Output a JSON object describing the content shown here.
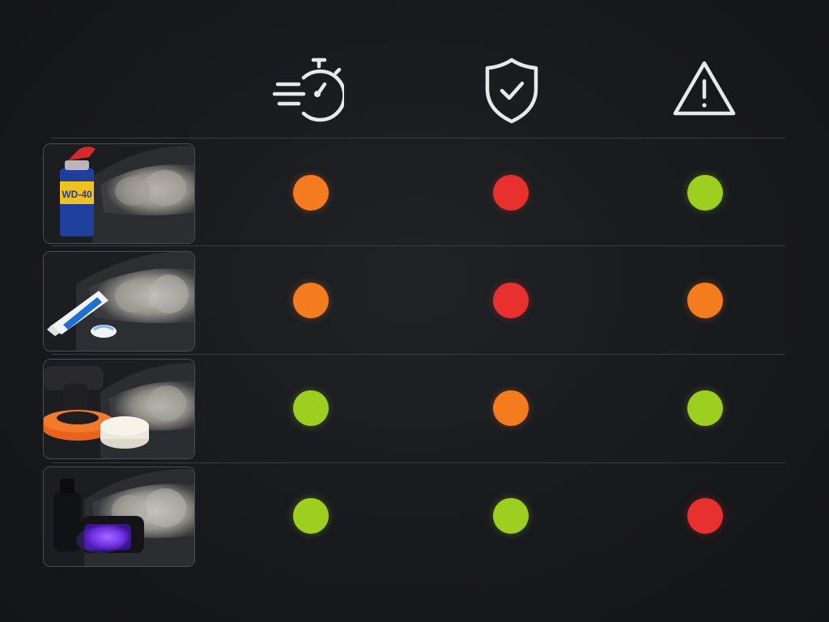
{
  "colors": {
    "background": "#18191c",
    "icon_stroke": "#e8e8e8",
    "divider": "#3a3c40",
    "rating": {
      "orange": "#f47b1e",
      "red": "#e8302e",
      "green": "#9ccf20"
    }
  },
  "header": {
    "columns": [
      {
        "icon": "stopwatch-speed-icon"
      },
      {
        "icon": "shield-check-icon"
      },
      {
        "icon": "warning-triangle-icon"
      }
    ]
  },
  "rows": [
    {
      "method_icon": "wd40-spray-can-headlight-image",
      "ratings": [
        "orange",
        "red",
        "green"
      ]
    },
    {
      "method_icon": "toothpaste-headlight-image",
      "ratings": [
        "orange",
        "red",
        "orange"
      ]
    },
    {
      "method_icon": "polisher-pads-headlight-image",
      "ratings": [
        "green",
        "orange",
        "green"
      ]
    },
    {
      "method_icon": "uv-coating-lamp-headlight-image",
      "ratings": [
        "green",
        "green",
        "red"
      ]
    }
  ]
}
